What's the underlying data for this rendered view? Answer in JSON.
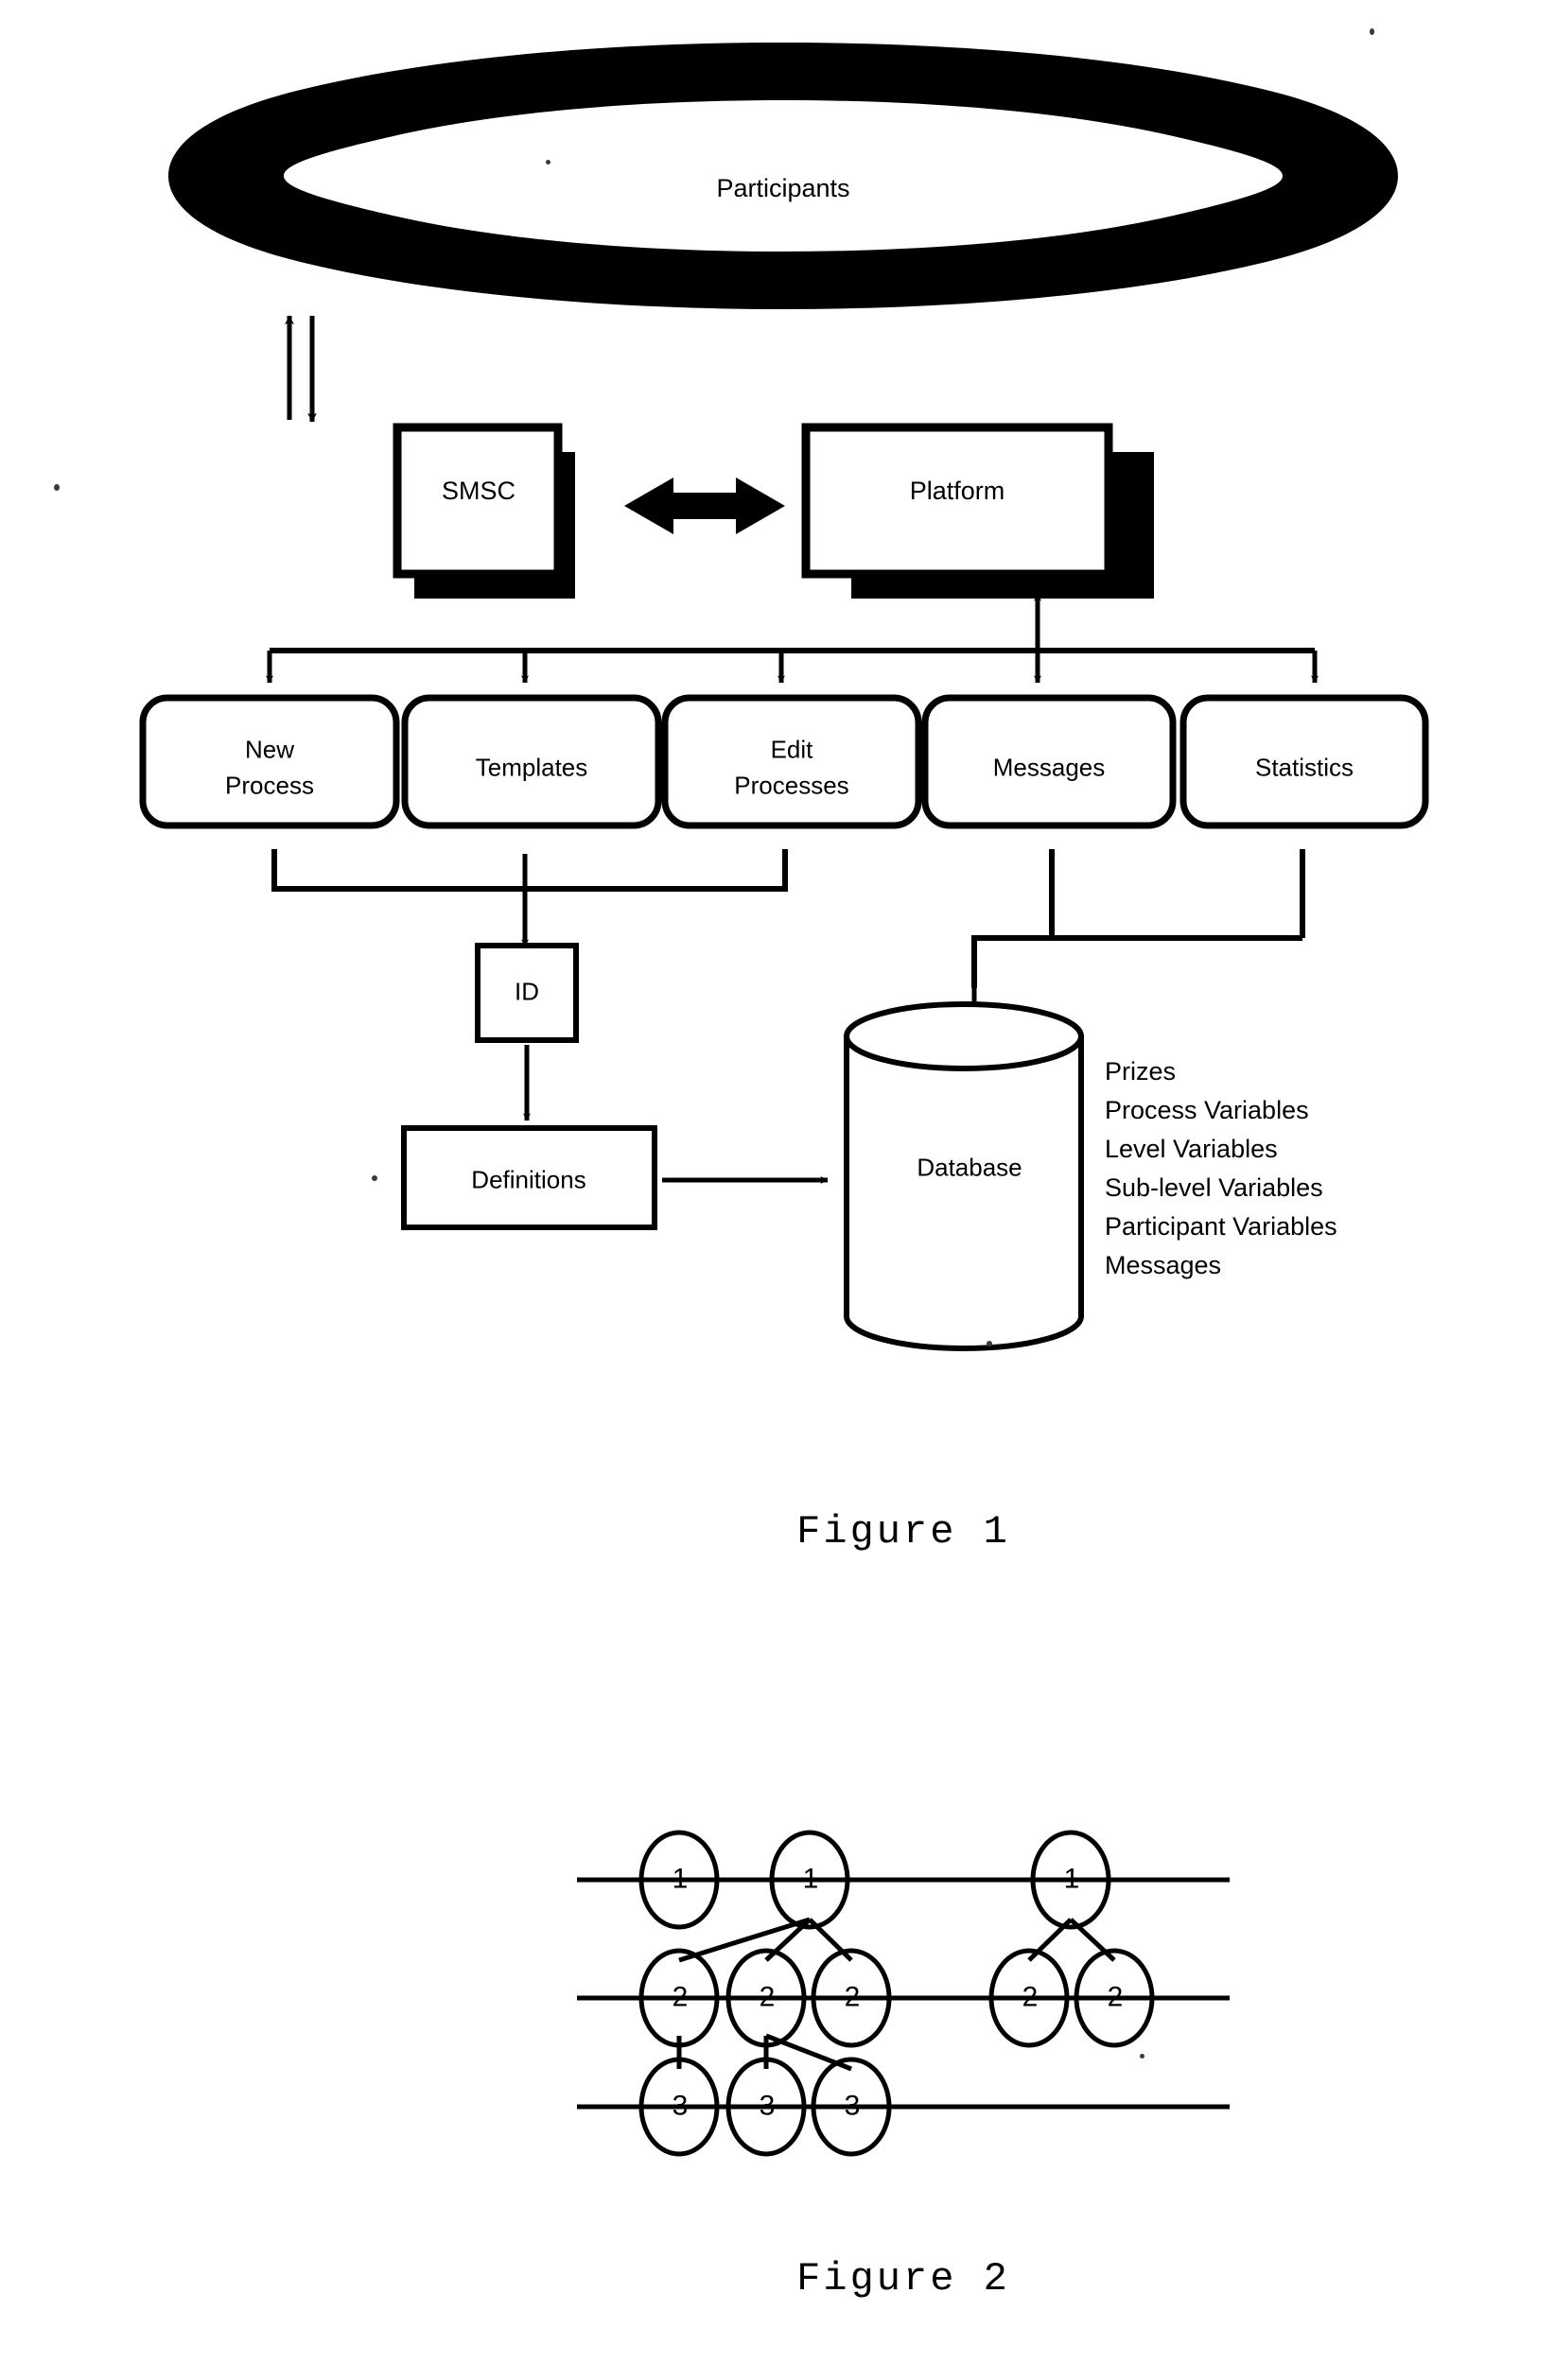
{
  "document": {
    "type": "patent-figure-sheet",
    "background_color": "#ffffff",
    "ink_color": "#000000"
  },
  "figure1": {
    "caption": "Figure 1",
    "participants": {
      "label": "Participants",
      "shape": "ellipse-ring"
    },
    "nodes": {
      "smsc": "SMSC",
      "platform": "Platform",
      "id": "ID",
      "definitions": "Definitions",
      "database": "Database"
    },
    "menu_boxes": [
      {
        "id": "new-process",
        "line1": "New",
        "line2": "Process"
      },
      {
        "id": "templates",
        "line1": "Templates",
        "line2": ""
      },
      {
        "id": "edit-processes",
        "line1": "Edit",
        "line2": "Processes"
      },
      {
        "id": "messages",
        "line1": "Messages",
        "line2": ""
      },
      {
        "id": "statistics",
        "line1": "Statistics",
        "line2": ""
      }
    ],
    "database_contents": [
      "Prizes",
      "Process Variables",
      "Level Variables",
      "Sub-level Variables",
      "Participant Variables",
      "Messages"
    ]
  },
  "figure2": {
    "caption": "Figure 2",
    "level_labels": [
      "1",
      "2",
      "3"
    ],
    "nodes": [
      {
        "id": "n1a",
        "label": "1",
        "level": 1
      },
      {
        "id": "n1b",
        "label": "1",
        "level": 1
      },
      {
        "id": "n1c",
        "label": "1",
        "level": 1
      },
      {
        "id": "n2a",
        "label": "2",
        "level": 2
      },
      {
        "id": "n2b",
        "label": "2",
        "level": 2
      },
      {
        "id": "n2c",
        "label": "2",
        "level": 2
      },
      {
        "id": "n2d",
        "label": "2",
        "level": 2
      },
      {
        "id": "n2e",
        "label": "2",
        "level": 2
      },
      {
        "id": "n3a",
        "label": "3",
        "level": 3
      },
      {
        "id": "n3b",
        "label": "3",
        "level": 3
      },
      {
        "id": "n3c",
        "label": "3",
        "level": 3
      }
    ],
    "edges": [
      {
        "from": "n1b",
        "to": "n2a"
      },
      {
        "from": "n1b",
        "to": "n2b"
      },
      {
        "from": "n1b",
        "to": "n2c"
      },
      {
        "from": "n1c",
        "to": "n2d"
      },
      {
        "from": "n1c",
        "to": "n2e"
      },
      {
        "from": "n2a",
        "to": "n3a"
      },
      {
        "from": "n2b",
        "to": "n3b"
      },
      {
        "from": "n2b",
        "to": "n3c"
      }
    ]
  }
}
